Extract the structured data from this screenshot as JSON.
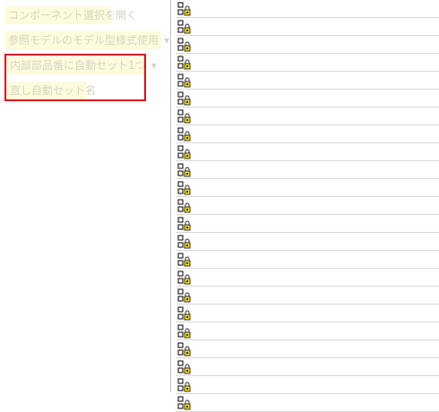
{
  "toolbar": {
    "open_component_selection": "コンポーネント選択を開く",
    "reference_model_mode": "参照モデルのモデル型様式使用",
    "inner_parts_auto_set": "内部部品番に自動セット1つ",
    "rename_auto_set": "直し自動セット名"
  },
  "highlight": {
    "color": "#e01010"
  },
  "list": {
    "row_icon": "component-lock-icon",
    "row_count": 23
  }
}
